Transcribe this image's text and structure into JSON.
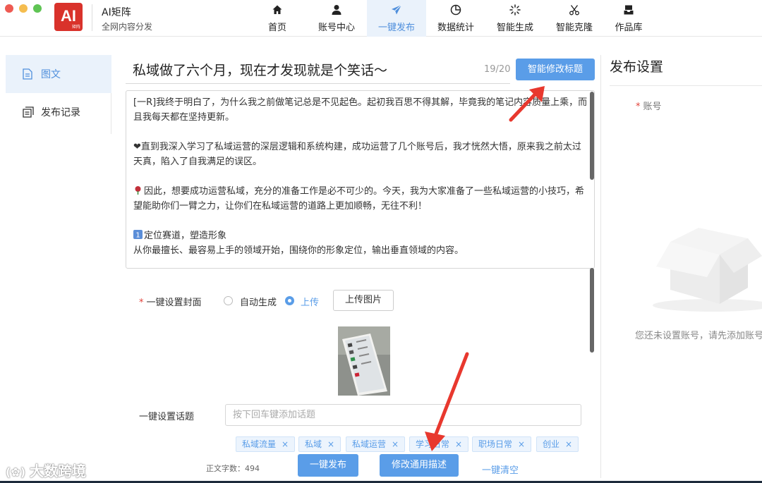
{
  "window": {
    "controls": [
      "#ee5a52",
      "#f5bd4f",
      "#5fc454"
    ]
  },
  "app": {
    "logo_text": "AI",
    "logo_sub": "矩阵",
    "name": "AI矩阵",
    "subtitle": "全网内容分发"
  },
  "nav": [
    {
      "label": "首页",
      "icon": "home-icon"
    },
    {
      "label": "账号中心",
      "icon": "user-icon"
    },
    {
      "label": "一键发布",
      "icon": "send-icon",
      "active": true
    },
    {
      "label": "数据统计",
      "icon": "pie-chart-icon"
    },
    {
      "label": "智能生成",
      "icon": "loading-icon"
    },
    {
      "label": "智能克隆",
      "icon": "scissors-icon"
    },
    {
      "label": "作品库",
      "icon": "inbox-icon"
    }
  ],
  "sidebar": [
    {
      "label": "图文",
      "icon": "document-icon",
      "active": true
    },
    {
      "label": "发布记录",
      "icon": "copy-icon"
    }
  ],
  "editor": {
    "title": "私域做了六个月，现在才发现就是个笑话～",
    "title_count": "19/20",
    "ai_title_button": "智能修改标题",
    "body": [
      "[一R]我终于明白了，为什么我之前做笔记总是不见起色。起初我百思不得其解，毕竟我的笔记内容质量上乘，而且我每天都在坚持更新。",
      "❤直到我深入学习了私域运营的深层逻辑和系统构建，成功运营了几个账号后，我才恍然大悟，原来我之前太过天真，陷入了自我满足的误区。",
      "因此，想要成功运营私域，充分的准备工作是必不可少的。今天，我为大家准备了一些私域运营的小技巧，希望能助你们一臂之力，让你们在私域运营的道路上更加顺畅，无往不利！",
      "定位赛道，塑造形象"
    ],
    "body_last": "从你最擅长、最容易上手的领域开始，围绕你的形象定位，输出垂直领域的内容。"
  },
  "cover": {
    "label": "一键设置封面",
    "option_auto": "自动生成",
    "option_upload": "上传",
    "upload_button": "上传图片",
    "selected": "上传"
  },
  "topic": {
    "label": "一键设置话题",
    "placeholder": "按下回车键添加话题",
    "tags": [
      "私域流量",
      "私域",
      "私域运营",
      "学习日常",
      "职场日常",
      "创业"
    ]
  },
  "footer": {
    "word_count": "正文字数：494",
    "publish_button": "一键发布",
    "desc_button": "修改通用描述",
    "clear_link": "一键清空",
    "watermark": "大数跨境"
  },
  "settings": {
    "title": "发布设置",
    "account_label": "账号",
    "empty_text": "您还未设置账号，请先添加账号"
  },
  "colors": {
    "accent": "#5a9de8",
    "brand": "#d9322b",
    "required": "#e2423a"
  }
}
